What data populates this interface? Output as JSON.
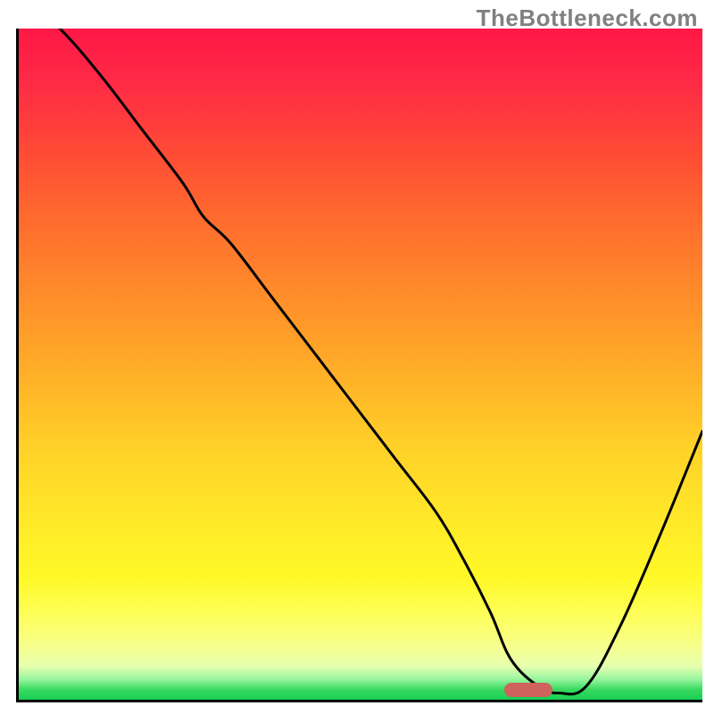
{
  "watermark": "TheBottleneck.com",
  "chart_data": {
    "type": "line",
    "title": "",
    "xlabel": "",
    "ylabel": "",
    "x_range": [
      0,
      100
    ],
    "y_range": [
      0,
      100
    ],
    "series": [
      {
        "name": "curve",
        "x": [
          0,
          6,
          12,
          18,
          24,
          27,
          31,
          37,
          43,
          49,
          55,
          61,
          65,
          69,
          72,
          76,
          79,
          83,
          88,
          94,
          100
        ],
        "y": [
          105,
          100,
          93,
          85,
          77,
          72,
          68,
          60,
          52,
          44,
          36,
          28,
          21,
          13,
          6,
          2,
          1,
          2,
          11,
          25,
          40
        ]
      }
    ],
    "marker": {
      "x": 74.5,
      "y": 1.5
    },
    "background_bands": [
      {
        "color": "#ff1846",
        "from": 100,
        "to": 92
      },
      {
        "color": "#ff6a2e",
        "from": 92,
        "to": 55
      },
      {
        "color": "#ffd028",
        "from": 55,
        "to": 28
      },
      {
        "color": "#fff928",
        "from": 28,
        "to": 12
      },
      {
        "color": "#e6ffb0",
        "from": 12,
        "to": 4
      },
      {
        "color": "#17cf55",
        "from": 4,
        "to": 0
      }
    ]
  }
}
